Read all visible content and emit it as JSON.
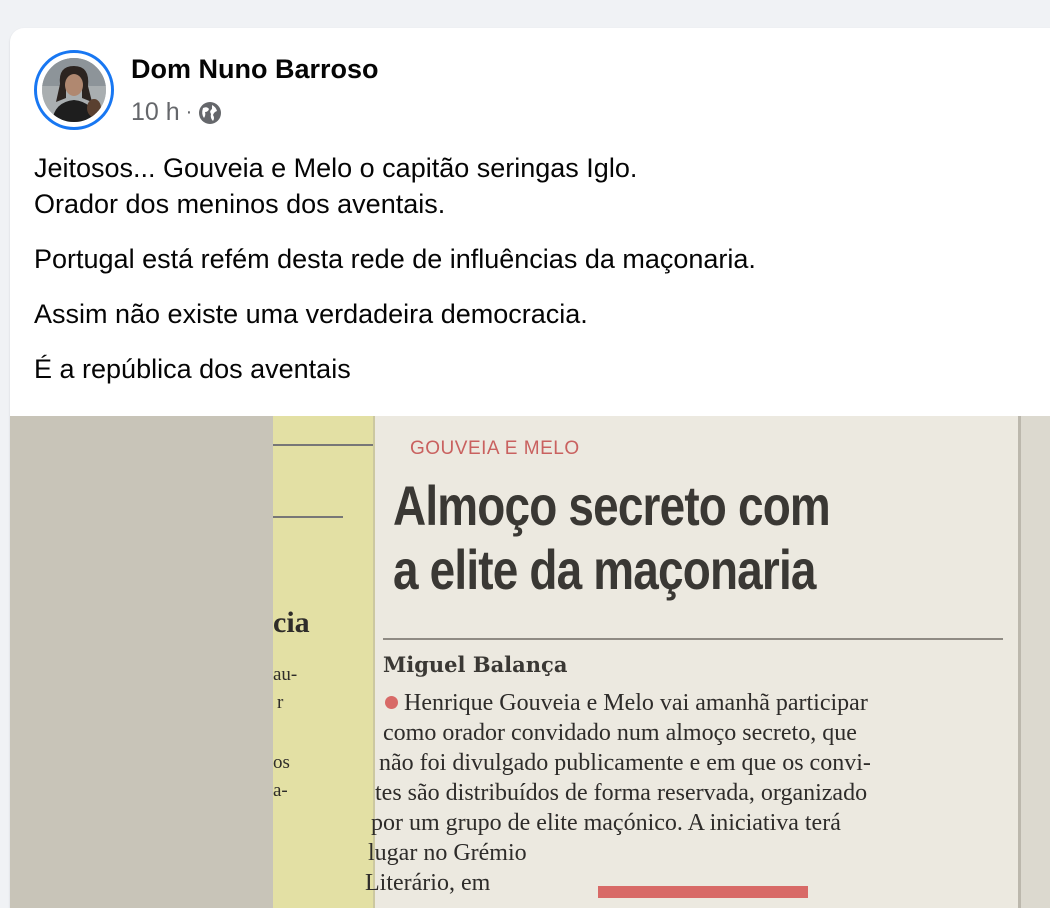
{
  "post": {
    "author": "Dom Nuno Barroso",
    "time": "10 h",
    "separator": "·",
    "audience_icon": "globe-icon",
    "paragraphs": [
      "Jeitosos... Gouveia e Melo o capitão seringas Iglo.\nOrador dos meninos dos aventais.",
      "Portugal está refém desta rede de influências da maçonaria.",
      "Assim não existe uma verdadeira democracia.",
      "É a república dos aventais"
    ]
  },
  "photo": {
    "kicker": "GOUVEIA E MELO",
    "headline_lines": [
      "Almoço secreto com",
      "a elite da maçonaria"
    ],
    "byline": "Miguel Balança",
    "body_lines": [
      "Henrique Gouveia e Melo vai amanhã participar",
      "como orador convidado num almoço secreto, que",
      "não foi divulgado publicamente e em que os convi-",
      "tes são distribuídos de forma reservada, organizado",
      "por um grupo de elite maçónico. A iniciativa terá",
      "lugar no Grémio",
      "Literário, em"
    ],
    "left_column": {
      "heading": "cia",
      "lines": [
        "au-",
        "r",
        "os",
        "a-"
      ]
    }
  },
  "colors": {
    "avatar_ring": "#1877f2",
    "kicker": "#c9615f",
    "meta_gray": "#65676b"
  }
}
